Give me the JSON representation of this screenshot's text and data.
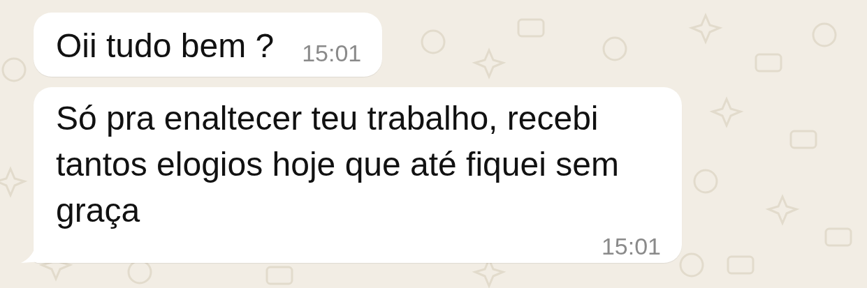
{
  "messages": [
    {
      "text": "Oii tudo bem ?",
      "time": "15:01",
      "tail": false
    },
    {
      "text": "Só pra enaltecer teu trabalho, recebi tantos elogios hoje que até fiquei sem graça",
      "time": "15:01",
      "tail": true
    }
  ]
}
